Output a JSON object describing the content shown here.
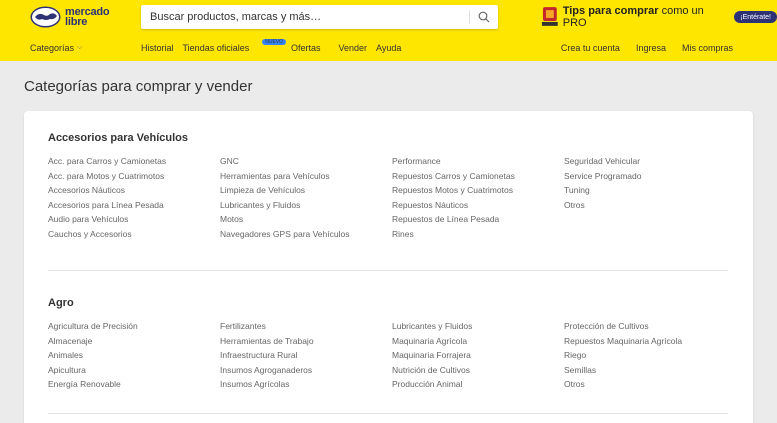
{
  "header": {
    "logo_line1": "mercado",
    "logo_line2": "libre",
    "search_placeholder": "Buscar productos, marcas y más…",
    "promo_bold": "Tips para comprar",
    "promo_rest": " como un PRO",
    "promo_button": "¡Entérate!",
    "categories_label": "Categorías",
    "nav_left": [
      "Historial",
      "Tiendas oficiales",
      "Ofertas",
      "Vender",
      "Ayuda"
    ],
    "new_badge": "NUEVO",
    "nav_right": [
      "Crea tu cuenta",
      "Ingresa",
      "Mis compras"
    ]
  },
  "page_title": "Categorías para comprar y vender",
  "sections": [
    {
      "title": "Accesorios para Vehículos",
      "columns": [
        [
          "Acc. para Carros y Camionetas",
          "Acc. para Motos y Cuatrimotos",
          "Accesorios Náuticos",
          "Accesorios para Línea Pesada",
          "Audio para Vehículos",
          "Cauchos y Accesorios"
        ],
        [
          "GNC",
          "Herramientas para Vehículos",
          "Limpieza de Vehículos",
          "Lubricantes y Fluidos",
          "Motos",
          "Navegadores GPS para Vehículos"
        ],
        [
          "Performance",
          "Repuestos Carros y Camionetas",
          "Repuestos Motos y Cuatrimotos",
          "Repuestos Náuticos",
          "Repuestos de Línea Pesada",
          "Rines"
        ],
        [
          "Seguridad Vehicular",
          "Service Programado",
          "Tuning",
          "Otros"
        ]
      ]
    },
    {
      "title": "Agro",
      "columns": [
        [
          "Agricultura de Precisión",
          "Almacenaje",
          "Animales",
          "Apicultura",
          "Energía Renovable"
        ],
        [
          "Fertilizantes",
          "Herramientas de Trabajo",
          "Infraestructura Rural",
          "Insumos Agroganaderos",
          "Insumos Agrícolas"
        ],
        [
          "Lubricantes y Fluidos",
          "Maquinaria Agrícola",
          "Maquinaria Forrajera",
          "Nutrición de Cultivos",
          "Producción Animal"
        ],
        [
          "Protección de Cultivos",
          "Repuestos Maquinaria Agrícola",
          "Riego",
          "Semillas",
          "Otros"
        ]
      ]
    }
  ],
  "colors": {
    "header_bg": "#ffe600",
    "brand_navy": "#2d3277",
    "new_badge": "#3483fa"
  }
}
